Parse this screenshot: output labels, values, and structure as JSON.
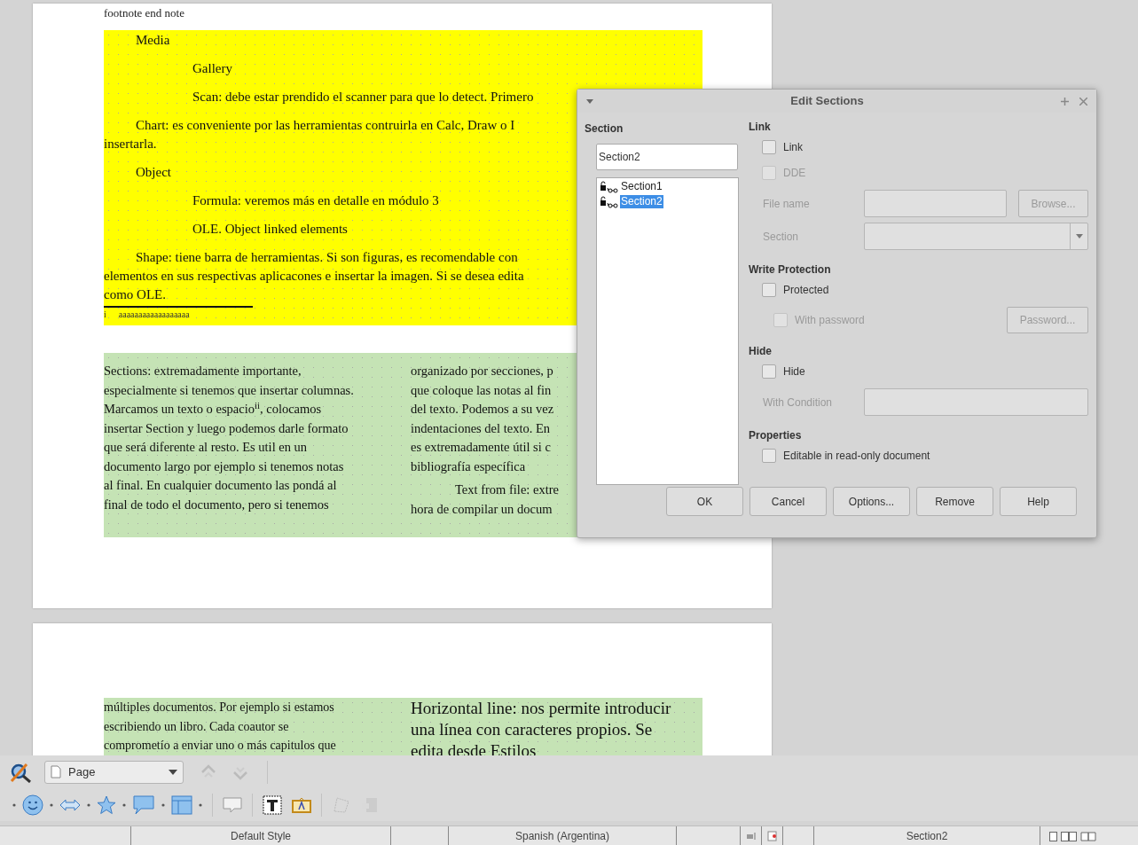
{
  "document": {
    "header_fragment": "footnote end note",
    "yellow_section": {
      "lines": [
        {
          "kind": "indented",
          "text": "Media"
        },
        {
          "kind": "nested",
          "text": "Gallery"
        },
        {
          "kind": "nested",
          "text": "Scan: debe estar prendido el scanner para que lo detect. Primero"
        },
        {
          "kind": "indented",
          "text": "Chart: es conveniente por las herramientas contruirla en Calc, Draw o I"
        },
        {
          "kind": "wrapped",
          "text": "insertarla."
        },
        {
          "kind": "indented",
          "text": "Object"
        },
        {
          "kind": "nested",
          "text": "Formula: veremos más en detalle en módulo 3"
        },
        {
          "kind": "nested",
          "text": "OLE. Object linked elements"
        },
        {
          "kind": "indented",
          "text": "Shape: tiene barra de herramientas. Si son figuras, es recomendable con"
        },
        {
          "kind": "wrapped",
          "text": "elementos en sus respectivas aplicacones e insertar la imagen. Si se desea edita"
        },
        {
          "kind": "wrapped",
          "text": "como OLE."
        }
      ],
      "footnote": {
        "mark": "i",
        "text": "aaaaaaaaaaaaaaaaaa"
      }
    },
    "green_section": {
      "left_lines": [
        "Sections: extremadamente importante,",
        "especialmente si tenemos que insertar columnas.",
        "Marcamos un texto o espacio$^{ii}$, colocamos",
        "insertar Section y luego podemos darle formato",
        "que será diferente al resto. Es util en un",
        "documento largo por ejemplo si tenemos notas",
        "al final. En cualquier documento las pondá al",
        "final de todo el documento, pero si tenemos"
      ],
      "right_lines": [
        {
          "kind": "wrapped",
          "text": "organizado por secciones, p"
        },
        {
          "kind": "wrapped",
          "text": "que coloque las notas al fin"
        },
        {
          "kind": "wrapped",
          "text": "del texto. Podemos a su vez"
        },
        {
          "kind": "wrapped",
          "text": "indentaciones del texto. En"
        },
        {
          "kind": "wrapped",
          "text": "es extremadamente útil si c"
        },
        {
          "kind": "wrapped",
          "text": "bibliografía específica"
        },
        {
          "kind": "indented",
          "text": "Text from file: extre"
        },
        {
          "kind": "wrapped",
          "text": "hora de compilar un docum"
        }
      ]
    },
    "page2": {
      "left_lines": [
        "múltiples documentos. Por ejemplo si estamos",
        "escribiendo un libro. Cada coautor se",
        "comprometío a enviar uno o más capitulos que"
      ],
      "right_lines": [
        "Horizontal line: nos permite introducir",
        "una línea con caracteres propios. Se",
        "edita desde Estilos"
      ]
    }
  },
  "dialog": {
    "title": "Edit Sections",
    "section_label": "Section",
    "name_value": "Section2",
    "sections": [
      {
        "label": "Section1",
        "selected": false
      },
      {
        "label": "Section2",
        "selected": true
      }
    ],
    "groups": [
      {
        "heading": "Link",
        "rows": [
          {
            "kind": "checkbox",
            "label": "Link",
            "checked": false,
            "disabled": false
          },
          {
            "kind": "checkbox",
            "label": "DDE",
            "checked": false,
            "disabled": true
          },
          {
            "kind": "field",
            "label": "File name",
            "disabled": true,
            "button": "Browse..."
          },
          {
            "kind": "dropdown",
            "label": "Section",
            "disabled": true
          }
        ]
      },
      {
        "heading": "Write Protection",
        "rows": [
          {
            "kind": "checkbox",
            "label": "Protected",
            "checked": false,
            "disabled": false
          },
          {
            "kind": "subcheckbox",
            "label": "With password",
            "checked": false,
            "disabled": true,
            "button": "Password..."
          }
        ]
      },
      {
        "heading": "Hide",
        "rows": [
          {
            "kind": "checkbox",
            "label": "Hide",
            "checked": false,
            "disabled": false
          },
          {
            "kind": "field",
            "label": "With Condition",
            "disabled": true
          }
        ]
      },
      {
        "heading": "Properties",
        "rows": [
          {
            "kind": "checkbox",
            "label": "Editable in read-only document",
            "checked": false,
            "disabled": false
          }
        ]
      }
    ],
    "buttons": [
      "OK",
      "Cancel",
      "Options...",
      "Remove",
      "Help"
    ]
  },
  "navigator_toolbar": {
    "dropdown": "Page"
  },
  "status_bar": {
    "page_style": "Default Style",
    "language": "Spanish (Argentina)",
    "section": "Section2"
  }
}
